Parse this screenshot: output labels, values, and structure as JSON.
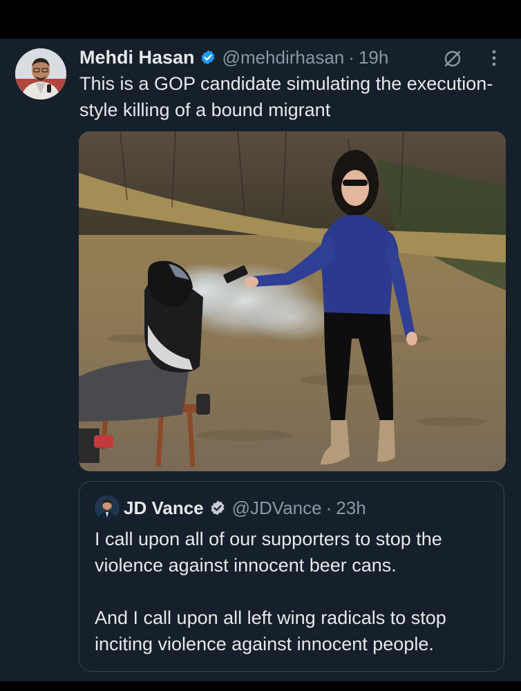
{
  "tweet": {
    "author_name": "Mehdi Hasan",
    "handle": "@mehdirhasan",
    "separator": "·",
    "time": "19h",
    "text": "This is a GOP candidate simulating the execution-style killing of a bound migrant",
    "icons": {
      "verified": "verified-badge-icon",
      "grok": "grok-icon",
      "more": "more-options-icon"
    }
  },
  "quoted_tweet": {
    "author_name": "JD Vance",
    "handle": "@JDVance",
    "separator": "·",
    "time": "23h",
    "paragraphs": [
      "I call upon all of our supporters to stop the violence against innocent beer cans.",
      "And I call upon all left wing radicals to stop inciting violence against innocent people."
    ]
  },
  "colors": {
    "background": "#15202b",
    "text_primary": "#e7e9ea",
    "text_secondary": "#8b98a5",
    "verified_blue": "#1d9bf0",
    "border": "#38444d"
  }
}
